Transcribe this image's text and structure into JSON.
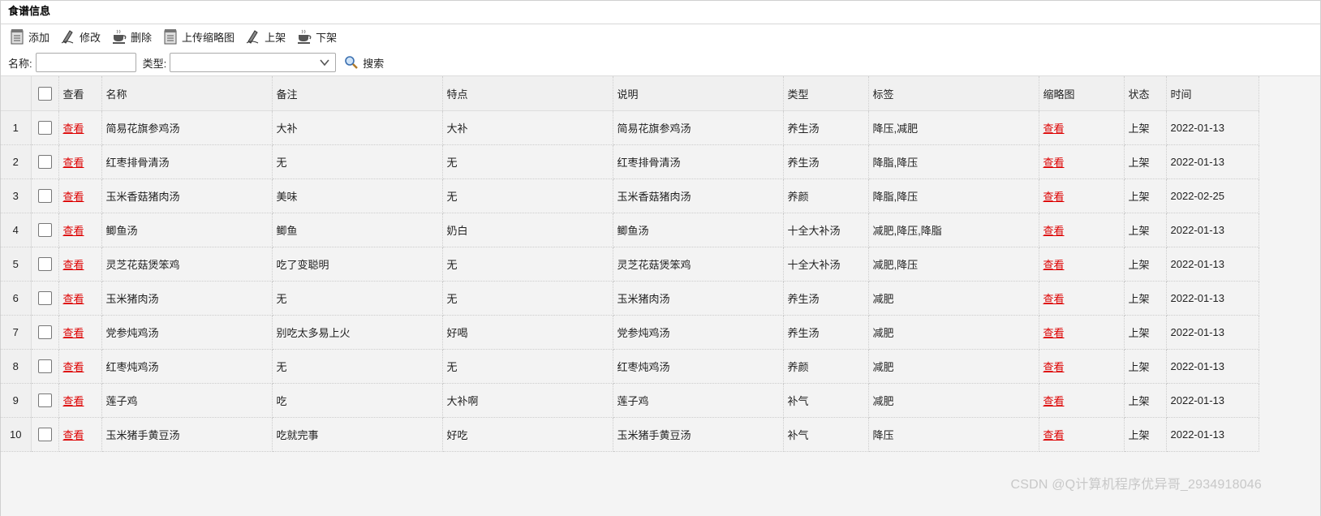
{
  "panel": {
    "title": "食谱信息"
  },
  "toolbar": {
    "add": "添加",
    "edit": "修改",
    "delete": "删除",
    "upload_thumb": "上传缩略图",
    "list": "上架",
    "unlist": "下架"
  },
  "search": {
    "name_label": "名称:",
    "name_value": "",
    "type_label": "类型:",
    "type_value": "",
    "button": "搜索"
  },
  "table": {
    "headers": {
      "view": "查看",
      "name": "名称",
      "remark": "备注",
      "feature": "特点",
      "desc": "说明",
      "type": "类型",
      "tags": "标签",
      "thumb": "缩略图",
      "status": "状态",
      "time": "时间"
    },
    "rows": [
      {
        "no": "1",
        "view": "查看",
        "name": "简易花旗参鸡汤",
        "remark": "大补",
        "feature": "大补",
        "desc": "简易花旗参鸡汤",
        "type": "养生汤",
        "tags": "降压,减肥",
        "thumb": "查看",
        "status": "上架",
        "time": "2022-01-13"
      },
      {
        "no": "2",
        "view": "查看",
        "name": "红枣排骨清汤",
        "remark": "无",
        "feature": "无",
        "desc": "红枣排骨清汤",
        "type": "养生汤",
        "tags": "降脂,降压",
        "thumb": "查看",
        "status": "上架",
        "time": "2022-01-13"
      },
      {
        "no": "3",
        "view": "查看",
        "name": "玉米香菇猪肉汤",
        "remark": "美味",
        "feature": "无",
        "desc": "玉米香菇猪肉汤",
        "type": "养颜",
        "tags": "降脂,降压",
        "thumb": "查看",
        "status": "上架",
        "time": "2022-02-25"
      },
      {
        "no": "4",
        "view": "查看",
        "name": "鲫鱼汤",
        "remark": "鲫鱼",
        "feature": "奶白",
        "desc": "鲫鱼汤",
        "type": "十全大补汤",
        "tags": "减肥,降压,降脂",
        "thumb": "查看",
        "status": "上架",
        "time": "2022-01-13"
      },
      {
        "no": "5",
        "view": "查看",
        "name": "灵芝花菇煲笨鸡",
        "remark": "吃了变聪明",
        "feature": "无",
        "desc": "灵芝花菇煲笨鸡",
        "type": "十全大补汤",
        "tags": "减肥,降压",
        "thumb": "查看",
        "status": "上架",
        "time": "2022-01-13"
      },
      {
        "no": "6",
        "view": "查看",
        "name": "玉米猪肉汤",
        "remark": "无",
        "feature": "无",
        "desc": "玉米猪肉汤",
        "type": "养生汤",
        "tags": "减肥",
        "thumb": "查看",
        "status": "上架",
        "time": "2022-01-13"
      },
      {
        "no": "7",
        "view": "查看",
        "name": "党参炖鸡汤",
        "remark": "别吃太多易上火",
        "feature": "好喝",
        "desc": "党参炖鸡汤",
        "type": "养生汤",
        "tags": "减肥",
        "thumb": "查看",
        "status": "上架",
        "time": "2022-01-13"
      },
      {
        "no": "8",
        "view": "查看",
        "name": "红枣炖鸡汤",
        "remark": "无",
        "feature": "无",
        "desc": "红枣炖鸡汤",
        "type": "养颜",
        "tags": "减肥",
        "thumb": "查看",
        "status": "上架",
        "time": "2022-01-13"
      },
      {
        "no": "9",
        "view": "查看",
        "name": "莲子鸡",
        "remark": "吃",
        "feature": "大补啊",
        "desc": "莲子鸡",
        "type": "补气",
        "tags": "减肥",
        "thumb": "查看",
        "status": "上架",
        "time": "2022-01-13"
      },
      {
        "no": "10",
        "view": "查看",
        "name": "玉米猪手黄豆汤",
        "remark": "吃就完事",
        "feature": "好吃",
        "desc": "玉米猪手黄豆汤",
        "type": "补气",
        "tags": "降压",
        "thumb": "查看",
        "status": "上架",
        "time": "2022-01-13"
      }
    ]
  },
  "watermark": "CSDN @Q计算机程序优异哥_2934918046",
  "colors": {
    "link": "#dd0000",
    "header_bg": "#f0f0f0",
    "grid_bg": "#f3f3f3"
  }
}
